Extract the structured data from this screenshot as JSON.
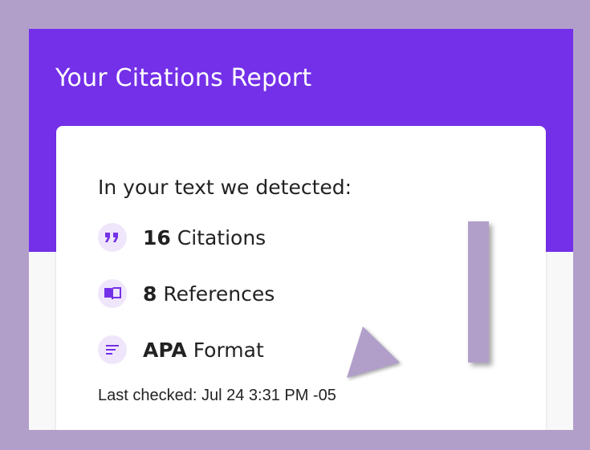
{
  "header": {
    "title": "Your Citations Report"
  },
  "report": {
    "intro": "In your text we detected:",
    "items": [
      {
        "icon": "quote-icon",
        "count": "16",
        "label": "Citations"
      },
      {
        "icon": "book-icon",
        "count": "8",
        "label": "References"
      },
      {
        "icon": "format-lines-icon",
        "count": "APA",
        "label": "Format"
      }
    ],
    "last_checked": "Last checked: Jul 24 3:31 PM -05"
  },
  "colors": {
    "frame": "#b19fca",
    "header": "#7430e8",
    "icon_bg": "#efe6fb",
    "accent": "#7430e8"
  }
}
